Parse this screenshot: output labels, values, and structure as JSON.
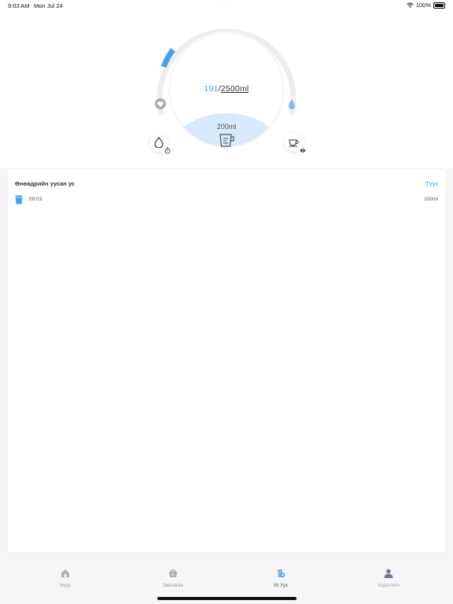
{
  "status_bar": {
    "time": "9:03 AM",
    "date": "Mon Jul 24",
    "battery": "100%"
  },
  "tracker": {
    "current": "191",
    "separator": "/",
    "goal": "2500ml",
    "cup_size": "200ml",
    "progress_fraction": 0.076,
    "accent_color": "#3ea3f0"
  },
  "history": {
    "title": "Өнөөдрийн уусан ус",
    "link": "Түүх",
    "entries": [
      {
        "time": "09:03",
        "amount": "200ml"
      }
    ]
  },
  "tabs": [
    {
      "label": "Нүүр",
      "icon": "home-icon"
    },
    {
      "label": "Зөвлөгөө",
      "icon": "basket-icon"
    },
    {
      "label": "Ус Уух",
      "icon": "water-drink-icon"
    },
    {
      "label": "Хэрэглэгч",
      "icon": "user-icon"
    }
  ]
}
